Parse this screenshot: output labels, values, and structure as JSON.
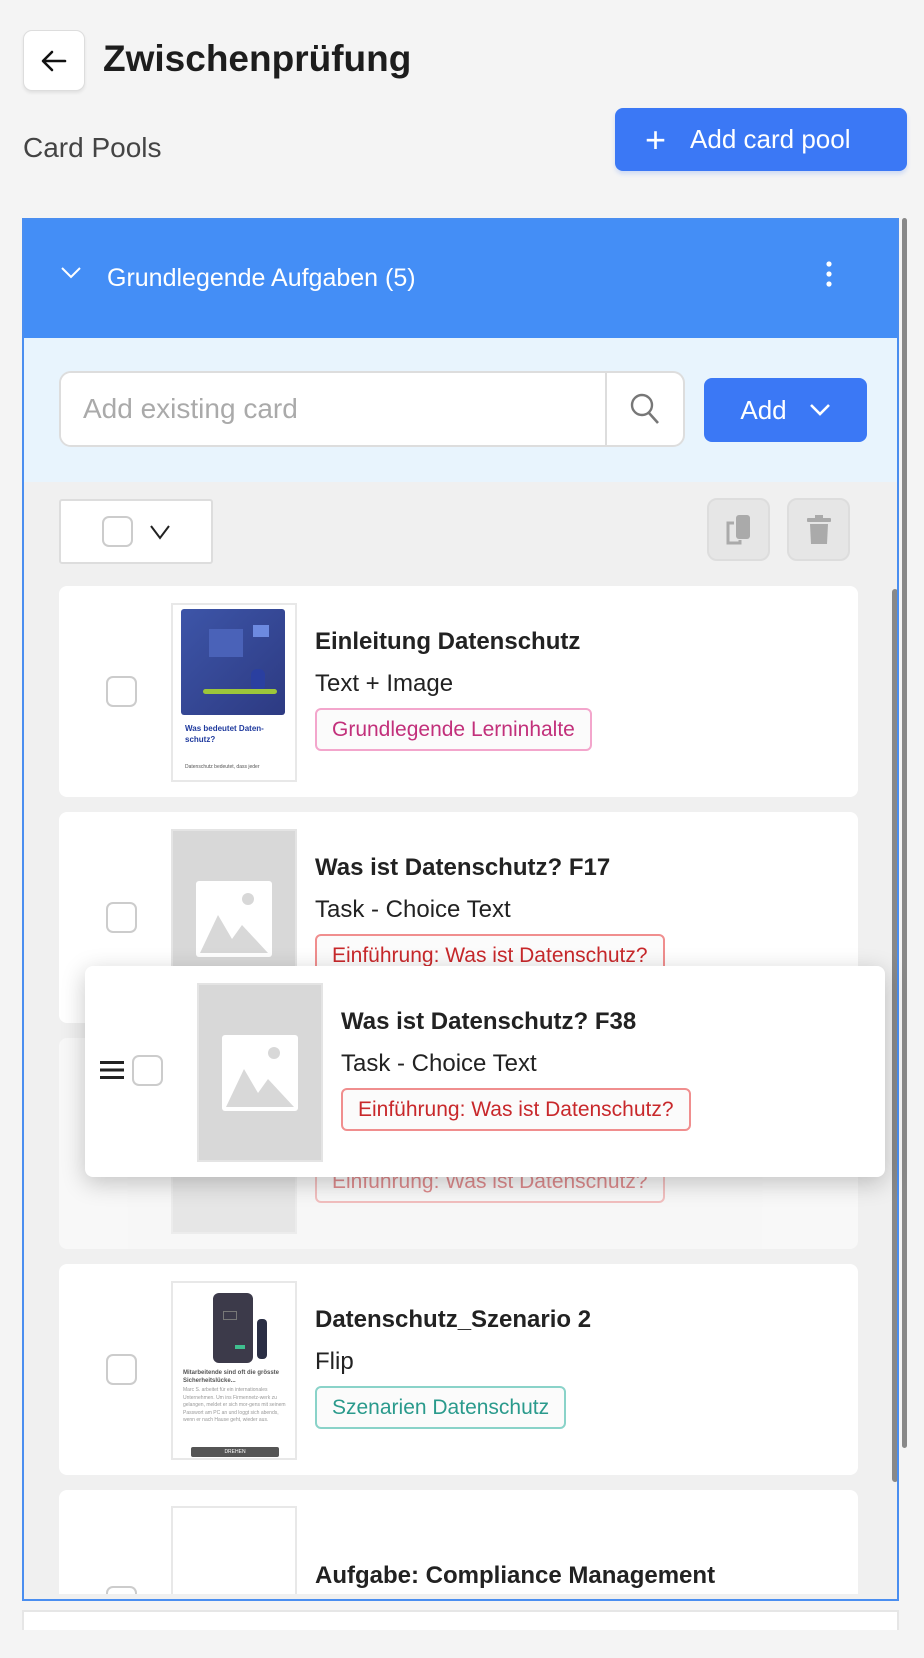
{
  "header": {
    "back_icon": "arrow-left-icon",
    "title": "Zwischenprüfung",
    "subheading": "Card Pools",
    "add_pool_label": "Add card pool",
    "add_pool_icon": "plus-icon"
  },
  "pool": {
    "title": "Grundlegende Aufgaben (5)",
    "expanded": true,
    "accent": "#448ef6",
    "search": {
      "placeholder": "Add existing card",
      "value": ""
    },
    "add_label": "Add",
    "cards": [
      {
        "title": "Einleitung Datenschutz",
        "type": "Text + Image",
        "tag": "Grundlegende Lerninhalte",
        "tag_color": "#c2307b",
        "thumb": {
          "heading": "Was bedeutet Daten-schutz?",
          "body": "Datenschutz bedeutet, dass jeder"
        }
      },
      {
        "title": "Was ist Datenschutz? F17",
        "type": "Task - Choice Text",
        "tag": "Einführung: Was ist Datenschutz?",
        "tag_color": "#c8282b"
      },
      {
        "title": "Was ist Datenschutz? F38",
        "type": "Task - Choice Text",
        "tag": "Einführung: Was ist Datenschutz?",
        "tag_color": "#c8282b",
        "dragging": true
      },
      {
        "title": "Datenschutz_Szenario 2",
        "type": "Flip",
        "tag": "Szenarien Datenschutz",
        "tag_color": "#2a9a8c",
        "thumb": {
          "heading": "Mitarbeitende sind oft die grösste Sicherheitslücke...",
          "body": "Marc S. arbeitet für ein internationales Unternehmen. Um ins Firmennetz-werk zu gelangen, meldet er sich mor-gens mit seinem Passwort am PC an und loggt sich abends, wenn er nach Hause geht, wieder aus.",
          "button": "DREHEN"
        }
      },
      {
        "title": "Aufgabe: Compliance Management"
      }
    ]
  }
}
